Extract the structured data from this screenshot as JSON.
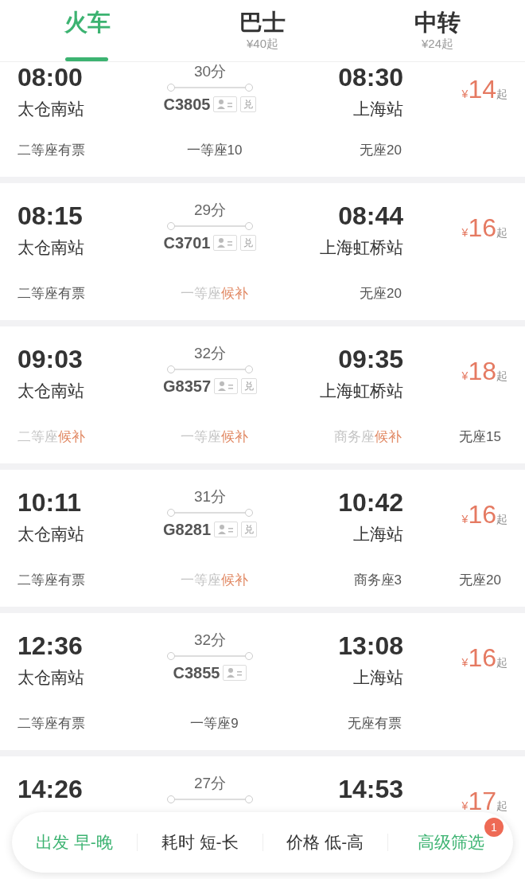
{
  "tabs": [
    {
      "label": "火车",
      "selected": true
    },
    {
      "label": "巴士",
      "subtitle": "¥40起",
      "selected": false
    },
    {
      "label": "中转",
      "subtitle": "¥24起",
      "selected": false
    }
  ],
  "trains": [
    {
      "depart": "08:00",
      "from": "太仓南站",
      "duration": "30分",
      "number": "C3805",
      "seat_select": true,
      "exchange": "兑",
      "arrive": "08:30",
      "to": "上海站",
      "price": "14",
      "price_prefix": "¥",
      "price_suffix": "起",
      "seats": [
        {
          "kind": "plain",
          "text": "二等座有票"
        },
        {
          "kind": "plain",
          "text": "一等座10"
        },
        {
          "kind": "plain",
          "text": "无座20"
        }
      ]
    },
    {
      "depart": "08:15",
      "from": "太仓南站",
      "duration": "29分",
      "number": "C3701",
      "seat_select": true,
      "exchange": "兑",
      "arrive": "08:44",
      "to": "上海虹桥站",
      "price": "16",
      "price_prefix": "¥",
      "price_suffix": "起",
      "seats": [
        {
          "kind": "plain",
          "text": "二等座有票"
        },
        {
          "kind": "waitlist",
          "text": "一等座",
          "status": "候补"
        },
        {
          "kind": "plain",
          "text": "无座20"
        }
      ]
    },
    {
      "depart": "09:03",
      "from": "太仓南站",
      "duration": "32分",
      "number": "G8357",
      "seat_select": true,
      "exchange": "兑",
      "arrive": "09:35",
      "to": "上海虹桥站",
      "price": "18",
      "price_prefix": "¥",
      "price_suffix": "起",
      "seats": [
        {
          "kind": "waitlist",
          "text": "二等座",
          "status": "候补"
        },
        {
          "kind": "waitlist",
          "text": "一等座",
          "status": "候补"
        },
        {
          "kind": "waitlist",
          "text": "商务座",
          "status": "候补"
        },
        {
          "kind": "plain",
          "text": "无座15"
        }
      ]
    },
    {
      "depart": "10:11",
      "from": "太仓南站",
      "duration": "31分",
      "number": "G8281",
      "seat_select": true,
      "exchange": "兑",
      "arrive": "10:42",
      "to": "上海站",
      "price": "16",
      "price_prefix": "¥",
      "price_suffix": "起",
      "seats": [
        {
          "kind": "plain",
          "text": "二等座有票"
        },
        {
          "kind": "waitlist",
          "text": "一等座",
          "status": "候补"
        },
        {
          "kind": "plain",
          "text": "商务座3"
        },
        {
          "kind": "plain",
          "text": "无座20"
        }
      ]
    },
    {
      "depart": "12:36",
      "from": "太仓南站",
      "duration": "32分",
      "number": "C3855",
      "seat_select": true,
      "arrive": "13:08",
      "to": "上海站",
      "price": "16",
      "price_prefix": "¥",
      "price_suffix": "起",
      "seats": [
        {
          "kind": "plain",
          "text": "二等座有票"
        },
        {
          "kind": "plain",
          "text": "一等座9"
        },
        {
          "kind": "plain",
          "text": "无座有票"
        }
      ]
    },
    {
      "depart": "14:26",
      "duration": "27分",
      "arrive": "14:53",
      "price": "17",
      "price_prefix": "¥",
      "price_suffix": "起"
    }
  ],
  "filter_bar": {
    "items": [
      {
        "label": "出发 早-晚",
        "active": true
      },
      {
        "label": "耗时 短-长",
        "active": false
      },
      {
        "label": "价格 低-高",
        "active": false
      },
      {
        "label": "高级筛选",
        "active": true,
        "badge": "1"
      }
    ]
  }
}
